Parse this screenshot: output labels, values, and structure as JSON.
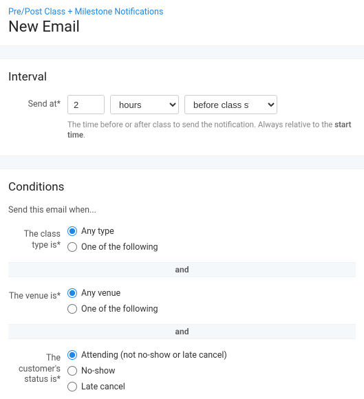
{
  "breadcrumb": {
    "label": "Pre/Post Class + Milestone Notifications"
  },
  "page_title": "New Email",
  "interval": {
    "heading": "Interval",
    "send_at_label": "Send at*",
    "value": "2",
    "unit_selected": "hours",
    "relative_selected": "before class starts",
    "help_prefix": "The time before or after class to send the notification. Always relative to the ",
    "help_bold": "start time",
    "help_suffix": "."
  },
  "conditions": {
    "heading": "Conditions",
    "intro": "Send this email when...",
    "separator_label": "and",
    "class_type": {
      "label": "The class type is*",
      "options": [
        "Any type",
        "One of the following"
      ],
      "selected": "Any type"
    },
    "venue": {
      "label": "The venue is*",
      "options": [
        "Any venue",
        "One of the following"
      ],
      "selected": "Any venue"
    },
    "status": {
      "label": "The customer's status is*",
      "options": [
        "Attending (not no-show or late cancel)",
        "No-show",
        "Late cancel"
      ],
      "selected": "Attending (not no-show or late cancel)"
    }
  }
}
